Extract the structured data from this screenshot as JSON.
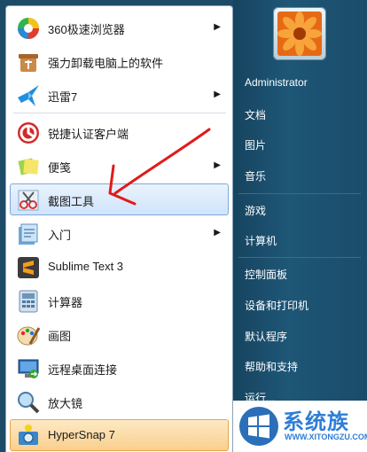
{
  "programs": [
    {
      "label": "360极速浏览器",
      "icon": "browser-360-icon",
      "has_arrow": true
    },
    {
      "label": "强力卸载电脑上的软件",
      "icon": "uninstall-icon",
      "has_arrow": false
    },
    {
      "label": "迅雷7",
      "icon": "thunder-bird-icon",
      "has_arrow": true
    },
    {
      "label": "锐捷认证客户端",
      "icon": "ruijie-client-icon",
      "has_arrow": false
    },
    {
      "label": "便笺",
      "icon": "sticky-notes-icon",
      "has_arrow": true
    },
    {
      "label": "截图工具",
      "icon": "snipping-tool-icon",
      "has_arrow": false
    },
    {
      "label": "入门",
      "icon": "getting-started-icon",
      "has_arrow": true
    },
    {
      "label": "Sublime Text 3",
      "icon": "sublime-text-icon",
      "has_arrow": false
    },
    {
      "label": "计算器",
      "icon": "calculator-icon",
      "has_arrow": false
    },
    {
      "label": "画图",
      "icon": "paint-icon",
      "has_arrow": false
    },
    {
      "label": "远程桌面连接",
      "icon": "remote-desktop-icon",
      "has_arrow": false
    },
    {
      "label": "放大镜",
      "icon": "magnifier-icon",
      "has_arrow": false
    },
    {
      "label": "HyperSnap 7",
      "icon": "hypersnap-icon",
      "has_arrow": false
    }
  ],
  "arrow_glyph": "▶",
  "right_menu": {
    "user": "Administrator",
    "items": [
      "文档",
      "图片",
      "音乐",
      "游戏",
      "计算机",
      "控制面板",
      "设备和打印机",
      "默认程序",
      "帮助和支持",
      "运行..."
    ]
  },
  "watermark": {
    "title": "系统族",
    "url": "WWW.XITONGZU.COM"
  },
  "colors": {
    "selected_bg": "#cfe4fb",
    "highlight_bg": "#f9cf8d",
    "right_panel": "#1e5676",
    "annotation": "#e01b1b",
    "logo_text": "#2e7dd6"
  }
}
